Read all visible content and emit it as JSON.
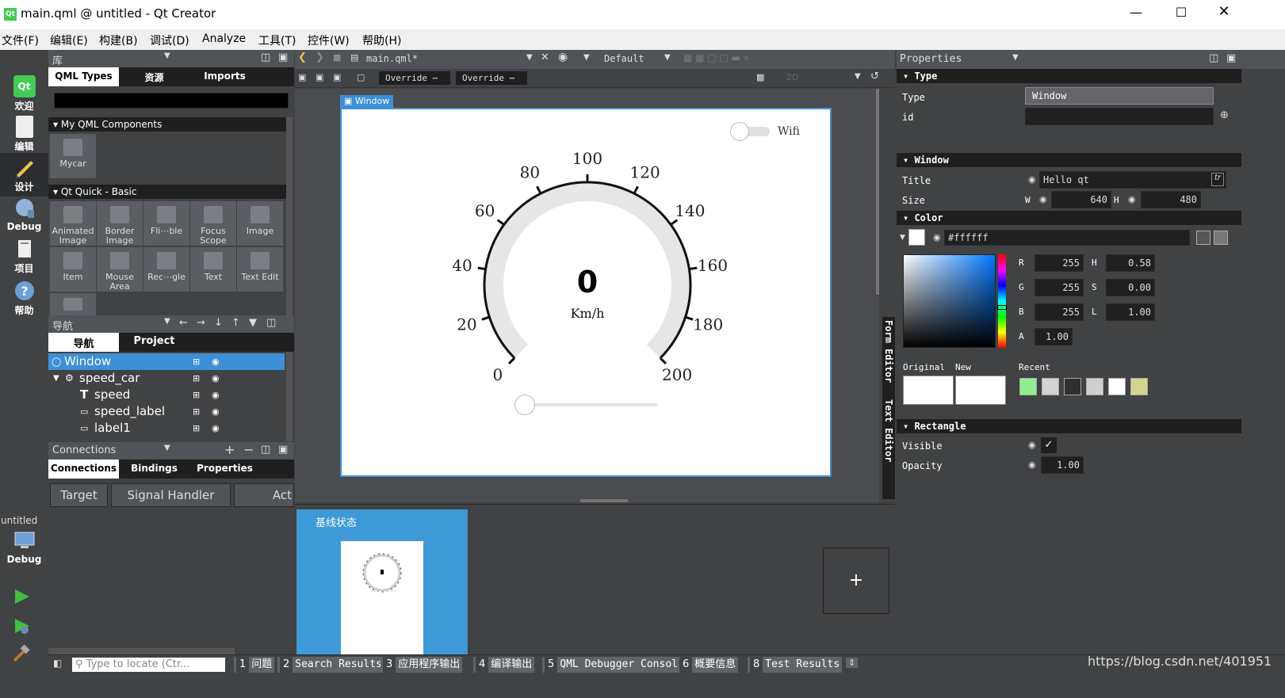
{
  "window": {
    "title": "main.qml @ untitled - Qt Creator",
    "app_logo": "Qt"
  },
  "menu": [
    "文件(F)",
    "编辑(E)",
    "构建(B)",
    "调试(D)",
    "Analyze",
    "工具(T)",
    "控件(W)",
    "帮助(H)"
  ],
  "modes": [
    {
      "label": "欢迎",
      "icon": "welcome-icon"
    },
    {
      "label": "编辑",
      "icon": "edit-icon"
    },
    {
      "label": "设计",
      "icon": "design-icon"
    },
    {
      "label": "Debug",
      "icon": "debug-icon"
    },
    {
      "label": "项目",
      "icon": "projects-icon"
    },
    {
      "label": "帮助",
      "icon": "help-icon"
    }
  ],
  "kit": {
    "project": "untitled",
    "label": "Debug"
  },
  "library": {
    "header": "库",
    "tabs": [
      "QML Types",
      "资源",
      "Imports"
    ],
    "sections": [
      "My QML Components",
      "Qt Quick - Basic"
    ],
    "my_components": [
      "Mycar"
    ],
    "basic": [
      "Animated Image",
      "Border Image",
      "Fli⋯ble",
      "Focus Scope",
      "Image",
      "Item",
      "Mouse Area",
      "Rec⋯gle",
      "Text",
      "Text Edit"
    ]
  },
  "navigator": {
    "header": "导航",
    "tabs": [
      "导航",
      "Project"
    ],
    "items": [
      {
        "label": "Window",
        "level": 0
      },
      {
        "label": "speed_car",
        "level": 1
      },
      {
        "label": "speed",
        "level": 2
      },
      {
        "label": "speed_label",
        "level": 2
      },
      {
        "label": "label1",
        "level": 2
      }
    ]
  },
  "connections": {
    "header": "Connections",
    "tabs": [
      "Connections",
      "Bindings",
      "Properties"
    ],
    "columns": [
      "Target",
      "Signal Handler",
      "Act"
    ]
  },
  "editor": {
    "file": "main.qml*",
    "style": "Default",
    "override1": "Override ⋯",
    "override2": "Override ⋯",
    "mode2d": "2D",
    "canvas_label": "Window",
    "side_tabs": [
      "Form Editor",
      "Text Editor"
    ]
  },
  "gauge": {
    "value": "0",
    "unit": "Km/h",
    "ticks": [
      "0",
      "20",
      "40",
      "60",
      "80",
      "100",
      "120",
      "140",
      "160",
      "180",
      "200"
    ],
    "switch_label": "Wifi",
    "switch_on": false,
    "slider_value": 0
  },
  "states": {
    "base": "基线状态",
    "add": "+"
  },
  "properties": {
    "header": "Properties",
    "type_section": "Type",
    "type_label": "Type",
    "type_value": "Window",
    "id_label": "id",
    "window_section": "Window",
    "title_label": "Title",
    "title_value": "Hello qt",
    "tr": "tr",
    "size_label": "Size",
    "w_label": "W",
    "w_value": "640",
    "h_label": "H",
    "h_value": "480",
    "color_section": "Color",
    "color_value": "#ffffff",
    "rgb": [
      {
        "k": "R",
        "v": "255"
      },
      {
        "k": "G",
        "v": "255"
      },
      {
        "k": "B",
        "v": "255"
      },
      {
        "k": "A",
        "v": "1.00"
      }
    ],
    "hsl": [
      {
        "k": "H",
        "v": "0.58"
      },
      {
        "k": "S",
        "v": "0.00"
      },
      {
        "k": "L",
        "v": "1.00"
      }
    ],
    "original_label": "Original",
    "new_label": "New",
    "recent_label": "Recent",
    "recent_colors": [
      "#90ee90",
      "#d3d3d3",
      "#2f2f2f",
      "#cfcfcf",
      "#ffffff",
      "#d6d38a"
    ],
    "rect_section": "Rectangle",
    "visible_label": "Visible",
    "visible_value": "✓",
    "opacity_label": "Opacity",
    "opacity_value": "1.00"
  },
  "statusbar": {
    "locate_placeholder": "Type to locate (Ctr...",
    "tabs": [
      {
        "n": "1",
        "label": "问题"
      },
      {
        "n": "2",
        "label": "Search Results"
      },
      {
        "n": "3",
        "label": "应用程序输出"
      },
      {
        "n": "4",
        "label": "编译输出"
      },
      {
        "n": "5",
        "label": "QML Debugger Console"
      },
      {
        "n": "6",
        "label": "概要信息"
      },
      {
        "n": "8",
        "label": "Test Results"
      }
    ],
    "watermark": "https://blog.csdn.net/401951"
  },
  "colors": {
    "accent": "#3d8fd6",
    "dark": "#1f1f1f",
    "panel": "#404244"
  }
}
